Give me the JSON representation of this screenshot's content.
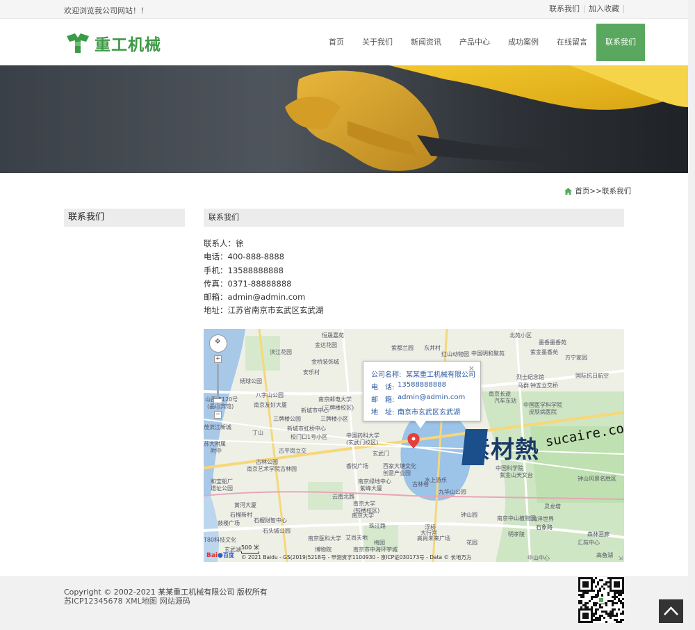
{
  "topbar": {
    "welcome": "欢迎浏览我公司网站！！",
    "links": [
      "联系我们",
      "加入收藏"
    ]
  },
  "header": {
    "logo_text": "重工机械",
    "nav": [
      "首页",
      "关于我们",
      "新闻资讯",
      "产品中心",
      "成功案例",
      "在线留言",
      "联系我们"
    ],
    "active_nav": "联系我们",
    "accent_color": "#5aa75f"
  },
  "breadcrumb": {
    "home": "首页",
    "separator": ">>",
    "current": "联系我们"
  },
  "sidebar": {
    "title": "联系我们"
  },
  "main": {
    "title": "联系我们",
    "contact": [
      {
        "label": "联系人：",
        "value": "徐"
      },
      {
        "label": "电话：",
        "value": "400-888-8888"
      },
      {
        "label": "手机：",
        "value": "13588888888"
      },
      {
        "label": "传真：",
        "value": "0371-88888888"
      },
      {
        "label": "邮箱：",
        "value": "admin@admin.com"
      },
      {
        "label": "地址：",
        "value": "江苏省南京市玄武区玄武湖"
      }
    ]
  },
  "map": {
    "popup": {
      "rows": [
        {
          "label": "公司名称:",
          "value": "某某重工机械有限公司"
        },
        {
          "label": "电　话:",
          "value": "13588888888"
        },
        {
          "label": "邮　箱:",
          "value": "admin@admin.com"
        },
        {
          "label": "地　址:",
          "value": "南京市玄武区玄武湖"
        }
      ],
      "close": "×"
    },
    "places": [
      "恒晟嘉苑",
      "北苑小区",
      "金达花园",
      "紫都兰园",
      "东井村",
      "墨香墨香苑",
      "滨江花园",
      "红山动物园",
      "中国明和聚苑",
      "紫金墨香苑",
      "金桥装饰城",
      "安乐村",
      "五塘村",
      "方宁家园",
      "国际抗日航空",
      "绣球公园",
      "烈士纪念馆",
      "八字山公园",
      "马群",
      "南京邮电大学",
      "(三牌楼校区)",
      "钟五立交桥",
      "南京友好大厦",
      "南京长途",
      "汽车东站",
      "中国医学科学院",
      "皮肤病医院",
      "三牌楼小区",
      "山西路120号",
      "(晶山宾馆)",
      "新城市中心",
      "三牌楼公园",
      "茂滨江新城",
      "丁山",
      "新城市虹桥中心",
      "校门口1号小区",
      "中国药科大学",
      "(玄武门校区)",
      "古平岗立交",
      "苏大附属",
      "附中",
      "古林公园",
      "南京艺术学院古林园",
      "香悦广场",
      "西家大塘文化",
      "创意产业园",
      "水上游乐",
      "古林巷",
      "和宝船厂",
      "遗址公园",
      "南京绿地中心",
      "紫峰大厦",
      "南京大学",
      "(鼓楼校区)",
      "玄武门",
      "紫金山天文台",
      "中国科学院",
      "钟山风景名胜区",
      "九华山公园",
      "黄河大厦",
      "云南北路",
      "钟山园",
      "灵龙塔",
      "石榴新村",
      "石榴财智中心",
      "海洋世界",
      "南京大学",
      "鼓楼广场",
      "珠江路",
      "浮桥",
      "大行宫",
      "石头城公园",
      "高尚未来广场",
      "石象路",
      "明孝陵",
      "森林画廊",
      "南京中山植物园",
      "汇苑中心",
      "南京医科大学",
      "艾尚天地",
      "梅园",
      "花园",
      "T80科技文化",
      "高备湖",
      "中山中心",
      "博物院",
      "南京市中海环宇城",
      "玄武湖"
    ],
    "scale": "500 米",
    "copyright": "© 2021 Baidu - GS(2019)5218号 - 甲测资字1100930 - 京ICP证030173号 - Data © 长地万方",
    "logo_text": "Bai",
    "logo_text2": "百度",
    "watermark": "素材熱",
    "watermark2": "sucaire.com"
  },
  "footer": {
    "copyright": "Copyright © 2002-2021 某某重工机械有限公司 版权所有",
    "icp": "苏ICP12345678",
    "links": [
      "XML地图",
      "网站源码"
    ]
  }
}
